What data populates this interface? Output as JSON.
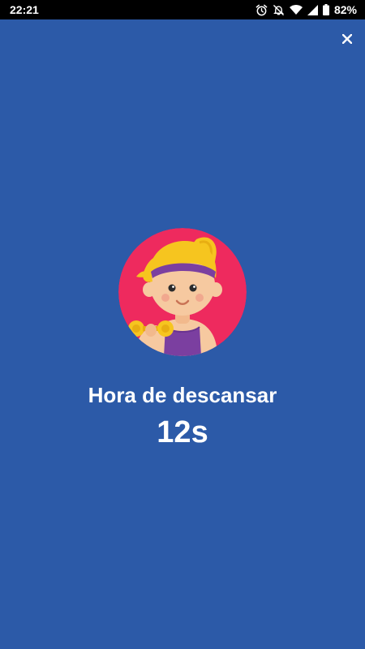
{
  "status_bar": {
    "time": "22:21",
    "battery_percent": "82%",
    "icons": [
      "alarm-icon",
      "notifications-off-icon",
      "wifi-icon",
      "cell-signal-icon",
      "battery-icon"
    ]
  },
  "header": {
    "close_icon": "close-icon",
    "close_glyph": "×"
  },
  "rest_screen": {
    "avatar": "woman-exercising-illustration",
    "title": "Hora de descansar",
    "countdown": "12s"
  },
  "colors": {
    "background": "#2C5AA8",
    "status_bar": "#000000",
    "avatar_circle": "#EE2A5E",
    "text": "#FFFFFF"
  }
}
